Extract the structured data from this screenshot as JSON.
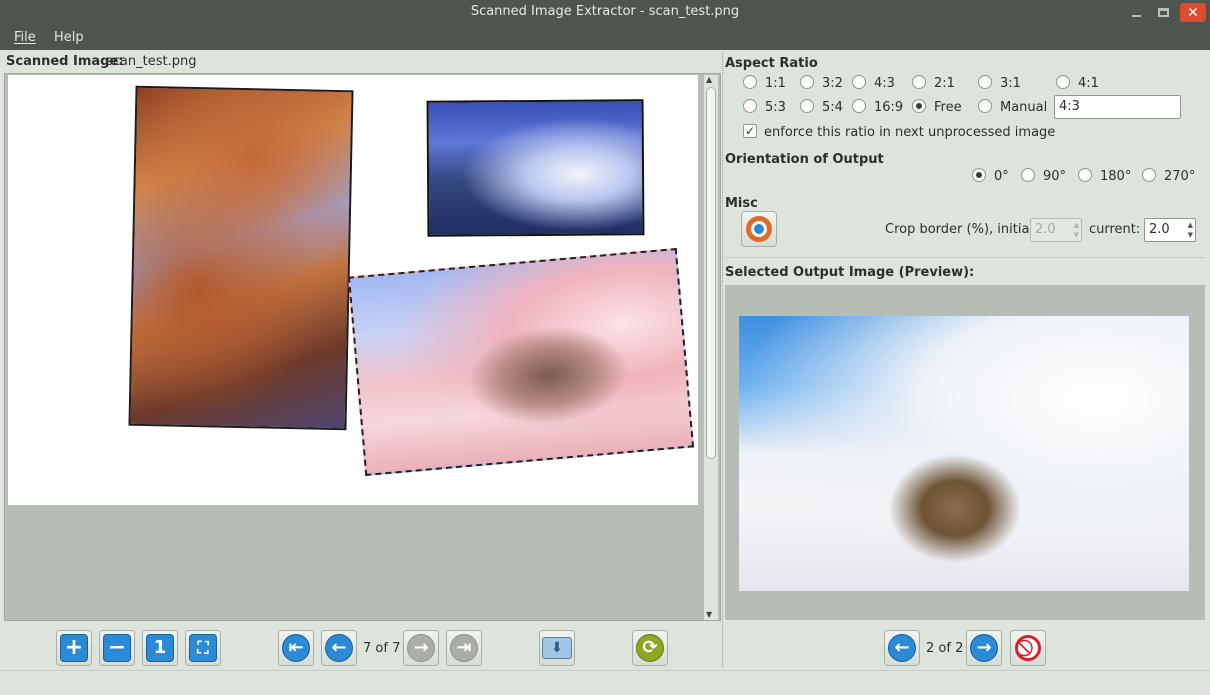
{
  "window": {
    "title": "Scanned Image Extractor - scan_test.png"
  },
  "menu": {
    "file": "File",
    "help": "Help"
  },
  "left": {
    "heading": "Scanned Image:",
    "filename": "scan_test.png",
    "photos": [
      "autumn-trees-photo",
      "waterfall-photo",
      "winter-field-photo"
    ]
  },
  "aspect": {
    "title": "Aspect Ratio",
    "options": [
      "1:1",
      "3:2",
      "4:3",
      "2:1",
      "3:1",
      "4:1",
      "5:3",
      "5:4",
      "16:9",
      "Free",
      "Manual"
    ],
    "selected": "Free",
    "manual_value": "4:3",
    "enforce_label": "enforce this ratio in next unprocessed image",
    "enforce_checked": true
  },
  "orientation": {
    "title": "Orientation of Output",
    "options": [
      "0°",
      "90°",
      "180°",
      "270°"
    ],
    "selected": "0°"
  },
  "misc": {
    "title": "Misc",
    "crop_label": "Crop border (%), initial:",
    "crop_initial": "2.0",
    "current_label": "current:",
    "crop_current": "2.0"
  },
  "preview": {
    "title": "Selected Output Image (Preview):"
  },
  "nav_left": {
    "page": "7 of 7"
  },
  "nav_right": {
    "page": "2 of 2"
  },
  "colors": {
    "titlebar": "#4e554d",
    "accent_blue": "#2b8ad6",
    "close_red": "#df4b2f"
  }
}
